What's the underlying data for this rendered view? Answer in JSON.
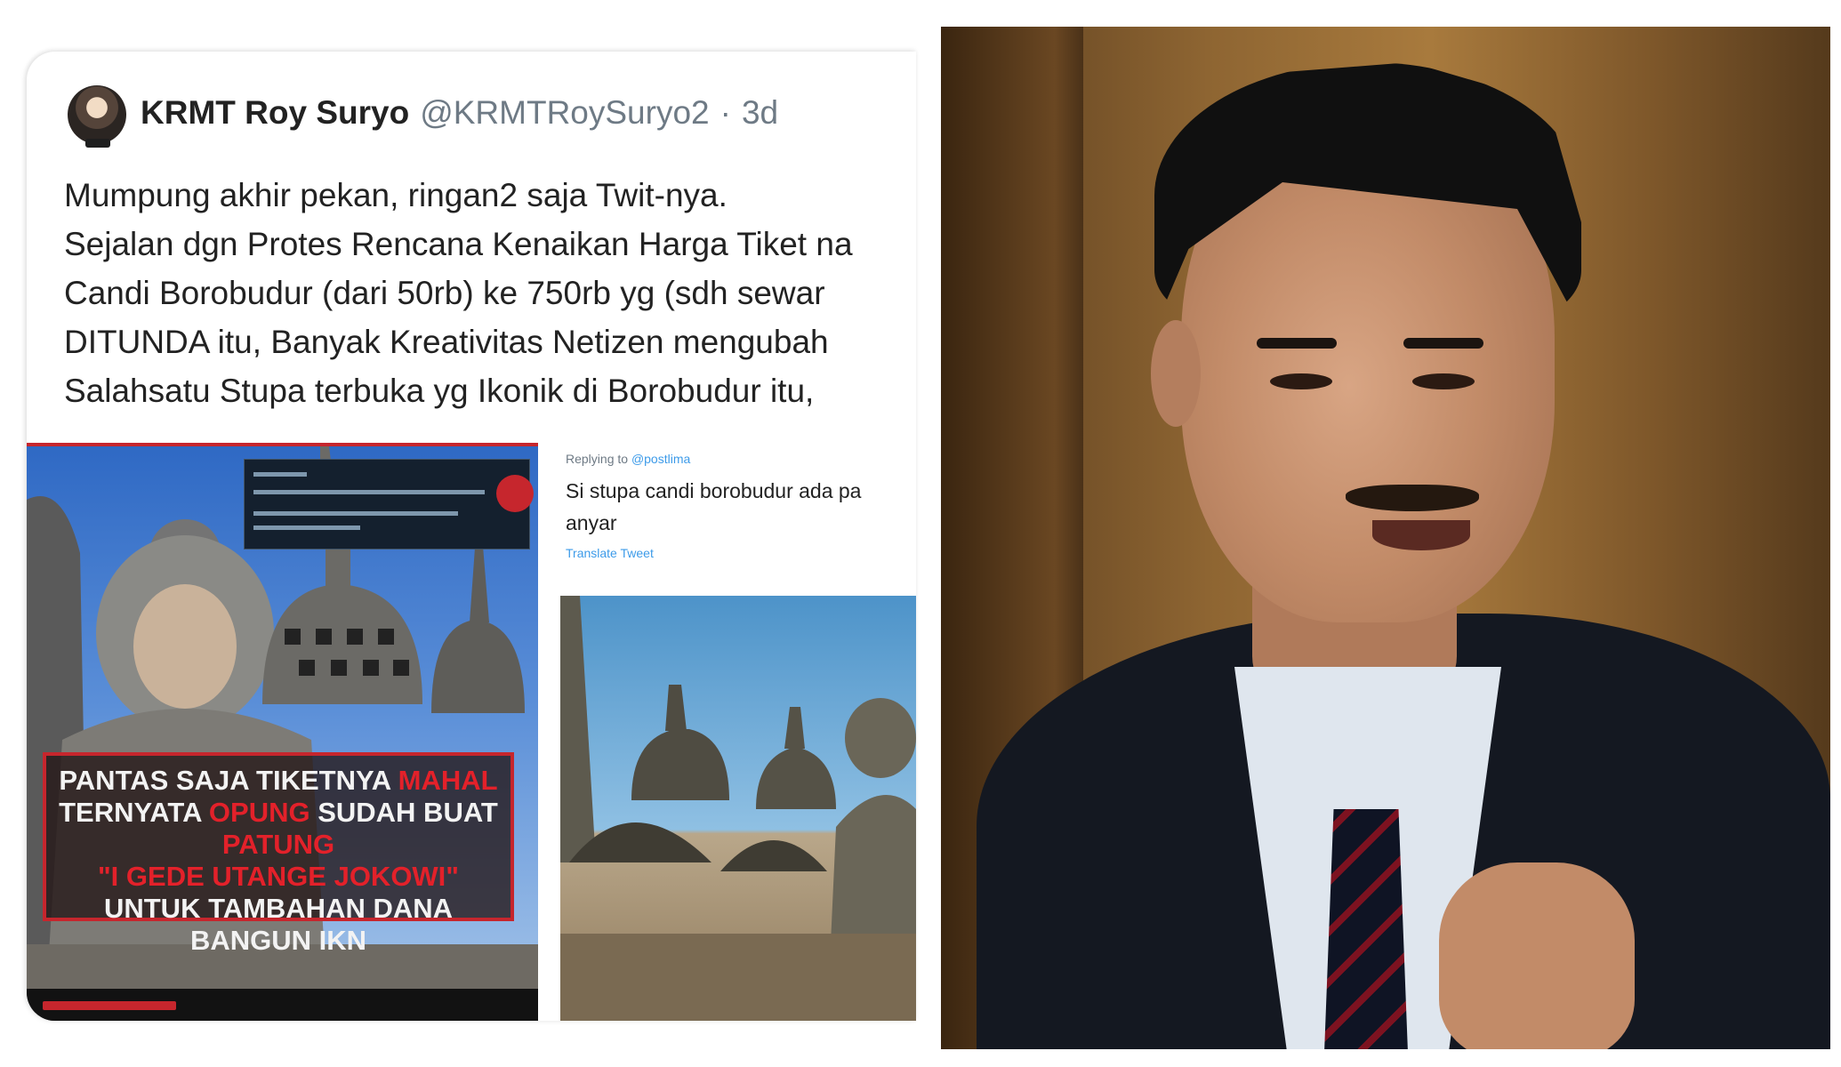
{
  "tweet": {
    "display_name": "KRMT Roy Suryo",
    "handle": "@KRMTRoySuryo2",
    "separator": "·",
    "age": "3d",
    "text_lines": [
      "Mumpung akhir pekan, ringan2 saja Twit-nya.",
      "Sejalan dgn Protes Rencana Kenaikan Harga Tiket na",
      "Candi Borobudur (dari 50rb) ke 750rb yg (sdh sewar",
      "DITUNDA itu, Banyak Kreativitas Netizen mengubah",
      "Salahsatu Stupa terbuka yg Ikonik di Borobudur itu,"
    ],
    "meme": {
      "caption_line1_a": "PANTAS SAJA TIKETNYA ",
      "caption_line1_b": "MAHAL",
      "caption_line2_a": "TERNYATA ",
      "caption_line2_b": "OPUNG",
      "caption_line2_c": " SUDAH BUAT ",
      "caption_line2_d": "PATUNG",
      "caption_line3": "\"I GEDE UTANGE JOKOWI\"",
      "caption_line4": "UNTUK TAMBAHAN DANA BANGUN IKN"
    },
    "reply": {
      "replying_prefix": "Replying to ",
      "replying_to": "@postlima",
      "text_line1": "Si stupa candi borobudur ada pa",
      "text_line2": "anyar",
      "translate_label": "Translate Tweet"
    }
  },
  "colors": {
    "accent_red": "#e3212a",
    "link_blue": "#3d9be9",
    "secondary_text": "#6e7a85"
  }
}
